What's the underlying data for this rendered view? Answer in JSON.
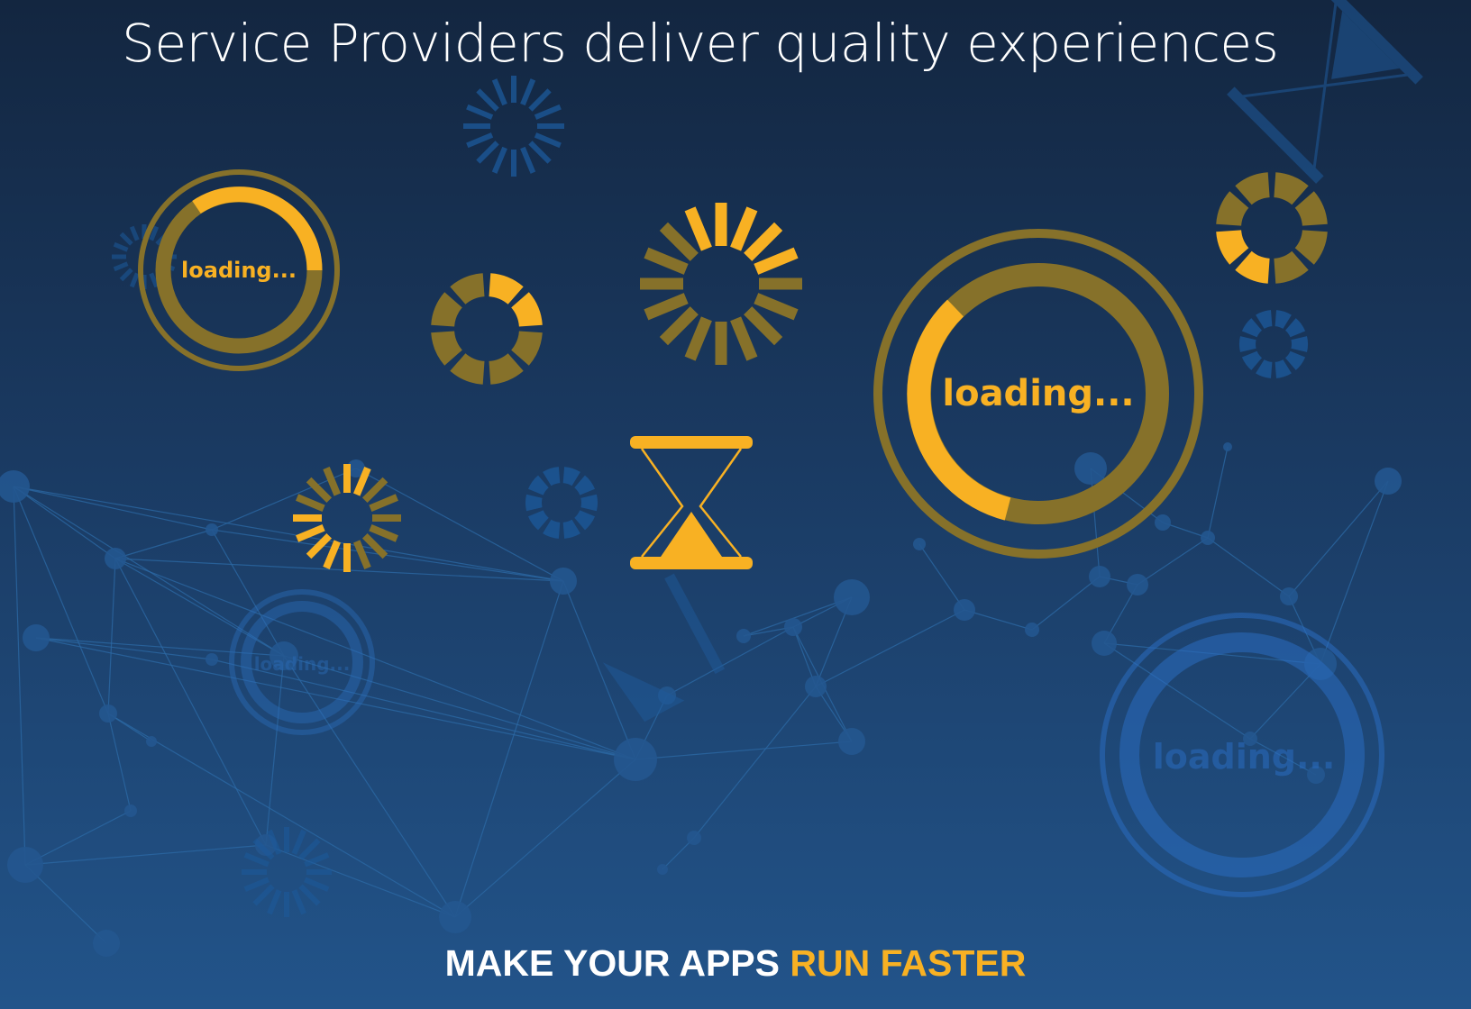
{
  "headline": "Service Providers deliver quality experiences",
  "tagline": {
    "lead": "MAKE YOUR APPS",
    "accent": "RUN FASTER"
  },
  "loading_labels": {
    "small": "loading...",
    "large": "loading...",
    "faded_small": "loading...",
    "faded_large": "loading..."
  },
  "colors": {
    "background_top": "#132640",
    "background_bottom": "#22548a",
    "accent_yellow": "#f8b123",
    "accent_dim": "#86712a",
    "network_blue": "#2e6ba8",
    "text": "#ffffff"
  },
  "icons": [
    "ring-loader-icon",
    "segment-spinner-icon",
    "ray-spinner-icon",
    "hourglass-icon",
    "dashed-spinner-icon",
    "network-graph-icon"
  ]
}
